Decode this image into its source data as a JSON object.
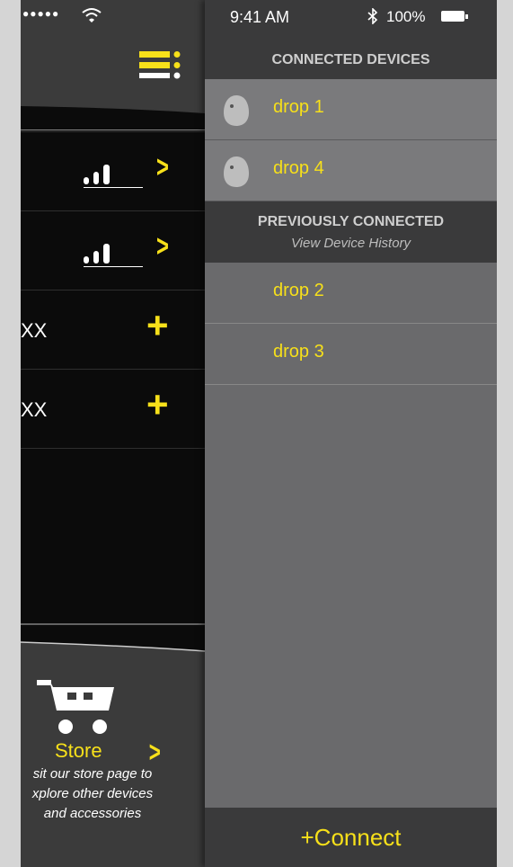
{
  "status_bar": {
    "signal_dots": "●●●●●",
    "wifi_icon": "wifi-icon",
    "time": "9:41 AM",
    "bluetooth_icon": "bluetooth-icon",
    "battery_percent": "100%"
  },
  "main_screen": {
    "rows": [
      {
        "type": "signal",
        "chevron": ">"
      },
      {
        "type": "signal",
        "chevron": ">"
      },
      {
        "type": "add",
        "label": "XX",
        "action": "+"
      },
      {
        "type": "add",
        "label": "XX",
        "action": "+"
      }
    ],
    "store": {
      "title": "Store",
      "chevron": ">",
      "description_line1": "sit our store page to",
      "description_line2": "xplore other devices",
      "description_line3": "and accessories"
    }
  },
  "drawer": {
    "connected_title": "CONNECTED DEVICES",
    "connected_devices": [
      {
        "name": "drop 1"
      },
      {
        "name": "drop 4"
      }
    ],
    "previous_title": "PREVIOUSLY CONNECTED",
    "previous_subtitle": "View Device History",
    "previous_devices": [
      {
        "name": "drop 2"
      },
      {
        "name": "drop 3"
      }
    ],
    "connect_label": "+Connect"
  },
  "colors": {
    "accent": "#f7e01a",
    "drawer_bg": "#6a6a6c",
    "header_bg": "#3a3a3b",
    "main_bg": "#0b0b0b"
  }
}
